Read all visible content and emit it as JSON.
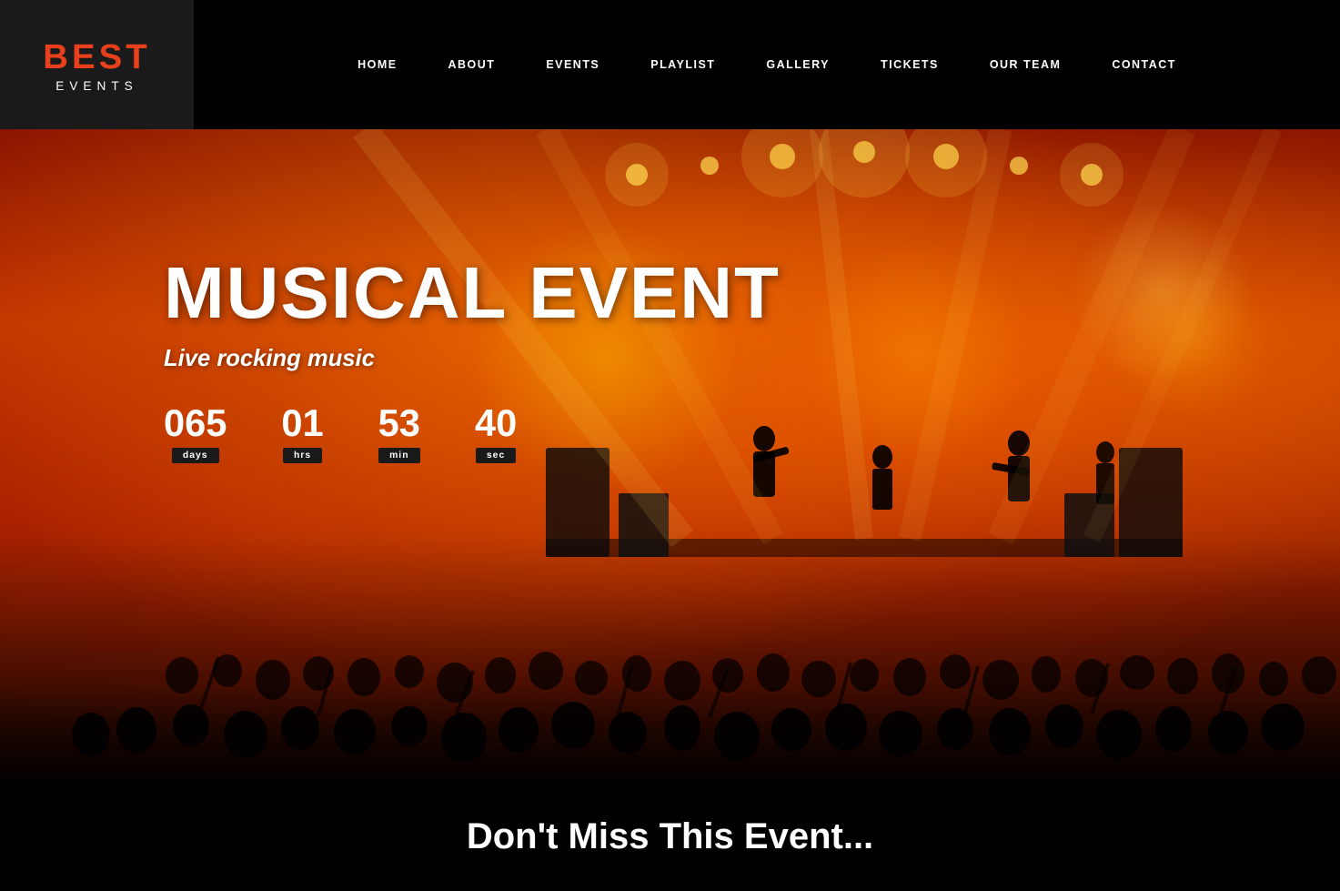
{
  "logo": {
    "best": "BEST",
    "events": "EVENTS"
  },
  "nav": {
    "items": [
      {
        "id": "home",
        "label": "HOME"
      },
      {
        "id": "about",
        "label": "ABOUT"
      },
      {
        "id": "events",
        "label": "EVENTS"
      },
      {
        "id": "playlist",
        "label": "PLAYLIST"
      },
      {
        "id": "gallery",
        "label": "GALLERY"
      },
      {
        "id": "tickets",
        "label": "TICKETS"
      },
      {
        "id": "our-team",
        "label": "OUR TEAM"
      },
      {
        "id": "contact",
        "label": "CONTACT"
      }
    ]
  },
  "hero": {
    "title": "MUSICAL EVENT",
    "subtitle": "Live rocking music",
    "countdown": {
      "days": {
        "value": "065",
        "label": "days"
      },
      "hrs": {
        "value": "01",
        "label": "hrs"
      },
      "min": {
        "value": "53",
        "label": "min"
      },
      "sec": {
        "value": "40",
        "label": "sec"
      }
    }
  },
  "bottom": {
    "title": "Don't Miss This Event..."
  },
  "colors": {
    "accent": "#e8401c",
    "brand_dark": "#1a1a1a",
    "nav_bg": "#000"
  }
}
